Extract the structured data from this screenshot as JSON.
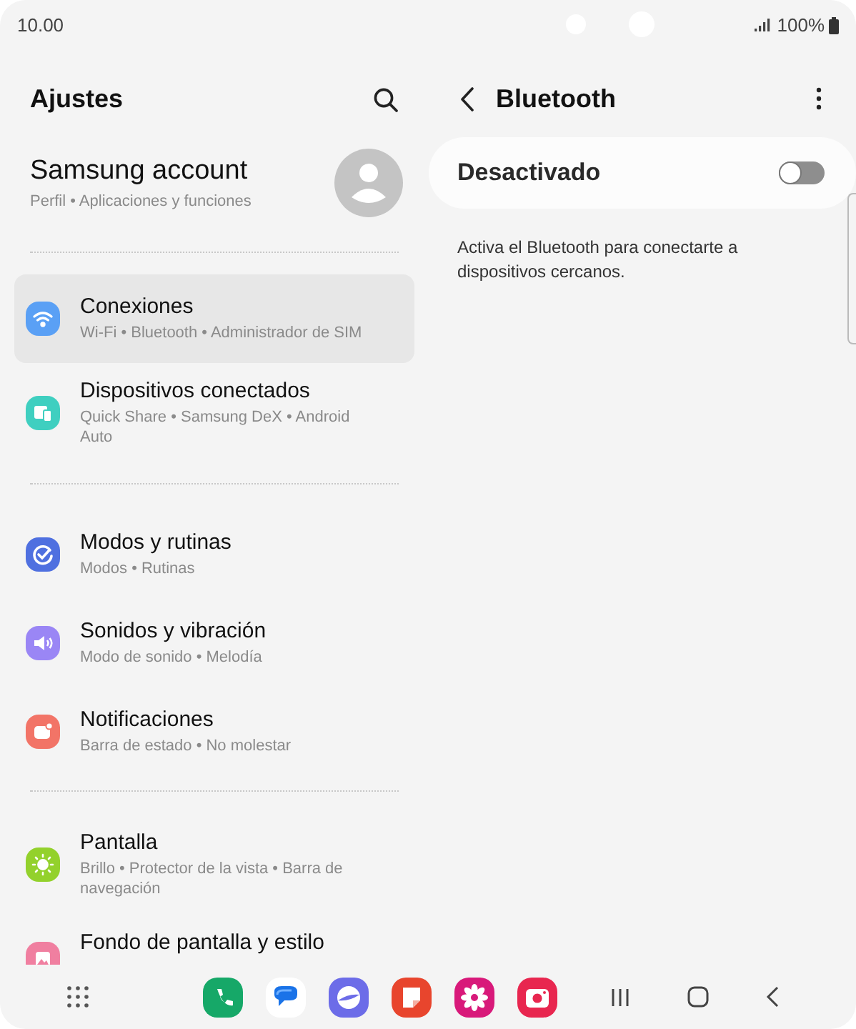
{
  "status_bar": {
    "time": "10.00",
    "battery": "100%"
  },
  "settings": {
    "title": "Ajustes",
    "account": {
      "name": "Samsung account",
      "subtitle": "Perfil • Aplicaciones y funciones"
    },
    "groups": [
      {
        "items": [
          {
            "kind": "wifi",
            "color": "#5aa0f5",
            "title": "Conexiones",
            "subtitle": "Wi-Fi • Bluetooth • Administrador de SIM",
            "selected": true
          },
          {
            "kind": "devices",
            "color": "#3fcfc0",
            "title": "Dispositivos conectados",
            "subtitle": "Quick Share • Samsung DeX • Android Auto",
            "selected": false
          }
        ]
      },
      {
        "items": [
          {
            "kind": "check",
            "color": "#4f70e0",
            "title": "Modos y rutinas",
            "subtitle": "Modos • Rutinas",
            "selected": false
          },
          {
            "kind": "sound",
            "color": "#9a86f5",
            "title": "Sonidos y vibración",
            "subtitle": "Modo de sonido • Melodía",
            "selected": false
          },
          {
            "kind": "notif",
            "color": "#f27467",
            "title": "Notificaciones",
            "subtitle": "Barra de estado • No molestar",
            "selected": false
          }
        ]
      },
      {
        "items": [
          {
            "kind": "sun",
            "color": "#93d12c",
            "title": "Pantalla",
            "subtitle": "Brillo • Protector de la vista • Barra de navegación",
            "selected": false
          },
          {
            "kind": "image",
            "color": "#f07fa0",
            "title": "Fondo de pantalla y estilo",
            "selected": false
          }
        ]
      }
    ]
  },
  "bluetooth": {
    "title": "Bluetooth",
    "switch_label": "Desactivado",
    "on": false,
    "description": "Activa el Bluetooth para conectarte a dispositivos cercanos."
  },
  "dock": {
    "apps": [
      {
        "kind": "phone",
        "color": "#16a868"
      },
      {
        "kind": "messages",
        "color": "#ffffff"
      },
      {
        "kind": "internet",
        "color": "#6c6ce8"
      },
      {
        "kind": "notes",
        "color": "#e8452d"
      },
      {
        "kind": "gallery",
        "color": "#d8197a"
      },
      {
        "kind": "camera",
        "color": "#e8264f"
      }
    ]
  }
}
